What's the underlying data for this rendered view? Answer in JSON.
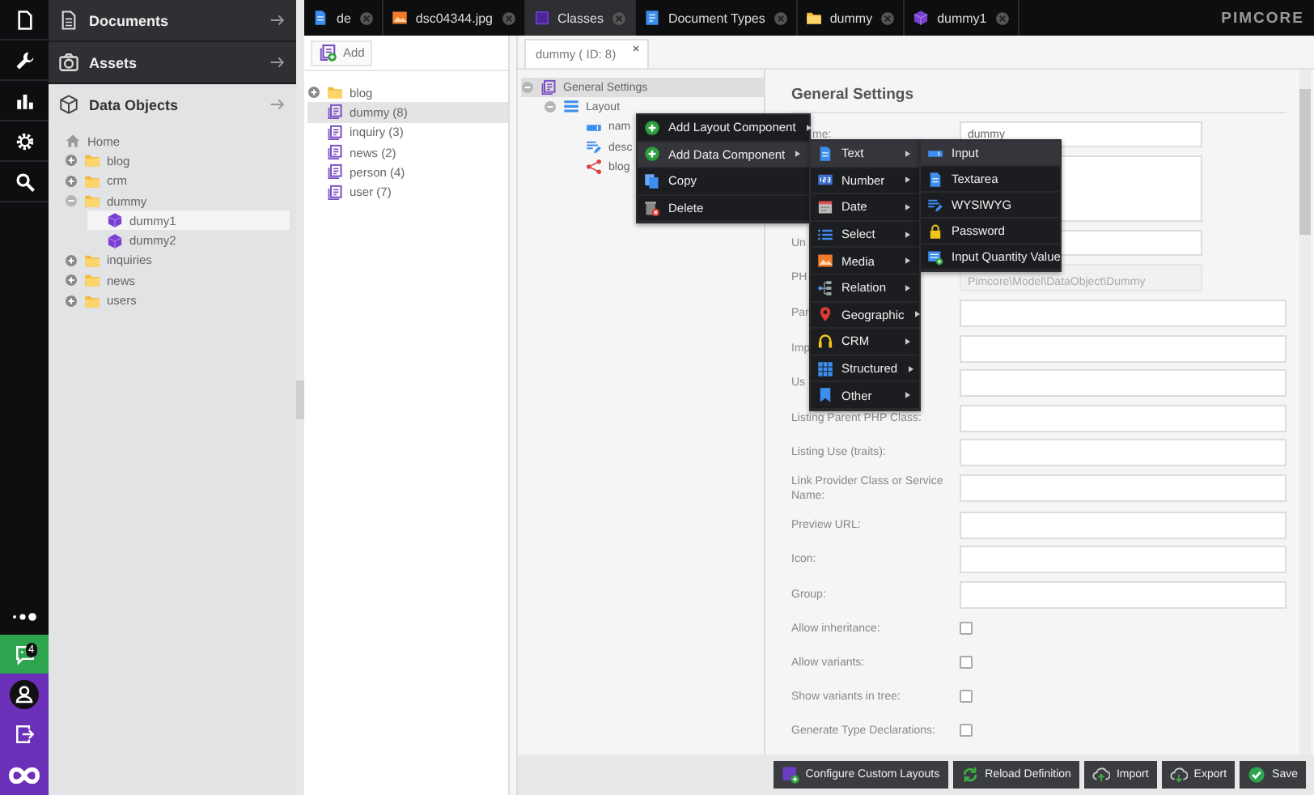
{
  "sidebar": {
    "panels": [
      {
        "title": "Documents",
        "selected": false
      },
      {
        "title": "Assets",
        "selected": false
      },
      {
        "title": "Data Objects",
        "selected": true
      }
    ],
    "tree": [
      {
        "label": "Home",
        "kind": "home",
        "selected": false,
        "children": [
          {
            "label": "blog",
            "kind": "folder",
            "expanded": false,
            "selected": false
          },
          {
            "label": "crm",
            "kind": "folder",
            "expanded": false,
            "selected": false
          },
          {
            "label": "dummy",
            "kind": "folder",
            "expanded": true,
            "selected": false,
            "children": [
              {
                "label": "dummy1",
                "kind": "object",
                "selected": true
              },
              {
                "label": "dummy2",
                "kind": "object",
                "selected": false
              }
            ]
          },
          {
            "label": "inquiries",
            "kind": "folder",
            "expanded": false,
            "selected": false
          },
          {
            "label": "news",
            "kind": "folder",
            "expanded": false,
            "selected": false
          },
          {
            "label": "users",
            "kind": "folder",
            "expanded": false,
            "selected": false
          }
        ]
      }
    ]
  },
  "notifications": {
    "count": "4"
  },
  "tabs": [
    {
      "label": "de",
      "selected": false
    },
    {
      "label": "dsc04344.jpg",
      "selected": false
    },
    {
      "label": "Classes",
      "selected": true
    },
    {
      "label": "Document Types",
      "selected": false
    },
    {
      "label": "dummy",
      "selected": false
    },
    {
      "label": "dummy1",
      "selected": false
    }
  ],
  "logo": "PIMCORE",
  "classes": {
    "add_button": "Add",
    "items": [
      {
        "label": "blog",
        "kind": "folder",
        "expanded": false,
        "selected": false
      },
      {
        "label": "dummy (8)",
        "kind": "class",
        "selected": true
      },
      {
        "label": "inquiry (3)",
        "kind": "class",
        "selected": false
      },
      {
        "label": "news (2)",
        "kind": "class",
        "selected": false
      },
      {
        "label": "person (4)",
        "kind": "class",
        "selected": false
      },
      {
        "label": "user (7)",
        "kind": "class",
        "selected": false
      }
    ]
  },
  "editor": {
    "tab": "dummy ( ID: 8)",
    "tree": [
      {
        "label": "General Settings",
        "kind": "settings",
        "expanded": true,
        "selected": true,
        "children": [
          {
            "label": "Layout",
            "kind": "layout",
            "expanded": true,
            "selected": false,
            "children": [
              {
                "label": "nam",
                "kind": "input",
                "selected": false
              },
              {
                "label": "desc",
                "kind": "textarea",
                "selected": false
              },
              {
                "label": "blog",
                "kind": "relation",
                "selected": false
              }
            ]
          }
        ]
      }
    ],
    "form": {
      "title": "General Settings",
      "rows": [
        {
          "kind": "short",
          "label": "me:",
          "value": "dummy",
          "disabled": false
        },
        {
          "kind": "textarea"
        },
        {
          "kind": "short",
          "label": "Un",
          "disabled": false
        },
        {
          "kind": "short",
          "label": "PH",
          "value": "Pimcore\\Model\\DataObject\\Dummy",
          "disabled": true
        },
        {
          "kind": "wide",
          "label": "Par",
          "disabled": false
        },
        {
          "kind": "wide",
          "label": "Imp",
          "disabled": false
        },
        {
          "kind": "wide",
          "label": "Us",
          "disabled": false
        },
        {
          "kind": "wide",
          "label": "Listing Parent PHP Class:",
          "disabled": false
        },
        {
          "kind": "wide",
          "label": "Listing Use (traits):",
          "disabled": false
        },
        {
          "kind": "wide",
          "label": "Link Provider Class or Service Name:",
          "disabled": false
        },
        {
          "kind": "wide",
          "label": "Preview URL:",
          "disabled": false
        },
        {
          "kind": "wide",
          "label": "Icon:",
          "disabled": false
        },
        {
          "kind": "wide",
          "label": "Group:",
          "disabled": false
        },
        {
          "kind": "checkbox",
          "label": "Allow inheritance:",
          "checked": false
        },
        {
          "kind": "checkbox",
          "label": "Allow variants:",
          "checked": false
        },
        {
          "kind": "checkbox",
          "label": "Show variants in tree:",
          "checked": false
        },
        {
          "kind": "checkbox",
          "label": "Generate Type Declarations:",
          "checked": false
        }
      ]
    },
    "buttons": [
      "Configure Custom Layouts",
      "Reload Definition",
      "Import",
      "Export",
      "Save"
    ]
  },
  "context_menu": {
    "items": [
      {
        "label": "Add Layout Component",
        "has_submenu": true,
        "selected": false
      },
      {
        "label": "Add Data Component",
        "has_submenu": true,
        "selected": true
      },
      {
        "label": "Copy",
        "has_submenu": false,
        "selected": false
      },
      {
        "label": "Delete",
        "has_submenu": false,
        "selected": false
      }
    ],
    "submenu": [
      {
        "label": "Text",
        "has_submenu": true,
        "selected": true
      },
      {
        "label": "Number",
        "has_submenu": true,
        "selected": false
      },
      {
        "label": "Date",
        "has_submenu": true,
        "selected": false
      },
      {
        "label": "Select",
        "has_submenu": true,
        "selected": false
      },
      {
        "label": "Media",
        "has_submenu": true,
        "selected": false
      },
      {
        "label": "Relation",
        "has_submenu": true,
        "selected": false
      },
      {
        "label": "Geographic",
        "has_submenu": true,
        "selected": false
      },
      {
        "label": "CRM",
        "has_submenu": true,
        "selected": false
      },
      {
        "label": "Structured",
        "has_submenu": true,
        "selected": false
      },
      {
        "label": "Other",
        "has_submenu": true,
        "selected": false
      }
    ],
    "submenu_2": [
      {
        "label": "Input",
        "has_submenu": false,
        "selected": true
      },
      {
        "label": "Textarea",
        "has_submenu": false,
        "selected": false
      },
      {
        "label": "WYSIWYG",
        "has_submenu": false,
        "selected": false
      },
      {
        "label": "Password",
        "has_submenu": false,
        "selected": false
      },
      {
        "label": "Input Quantity Value",
        "has_submenu": false,
        "selected": false
      }
    ]
  }
}
